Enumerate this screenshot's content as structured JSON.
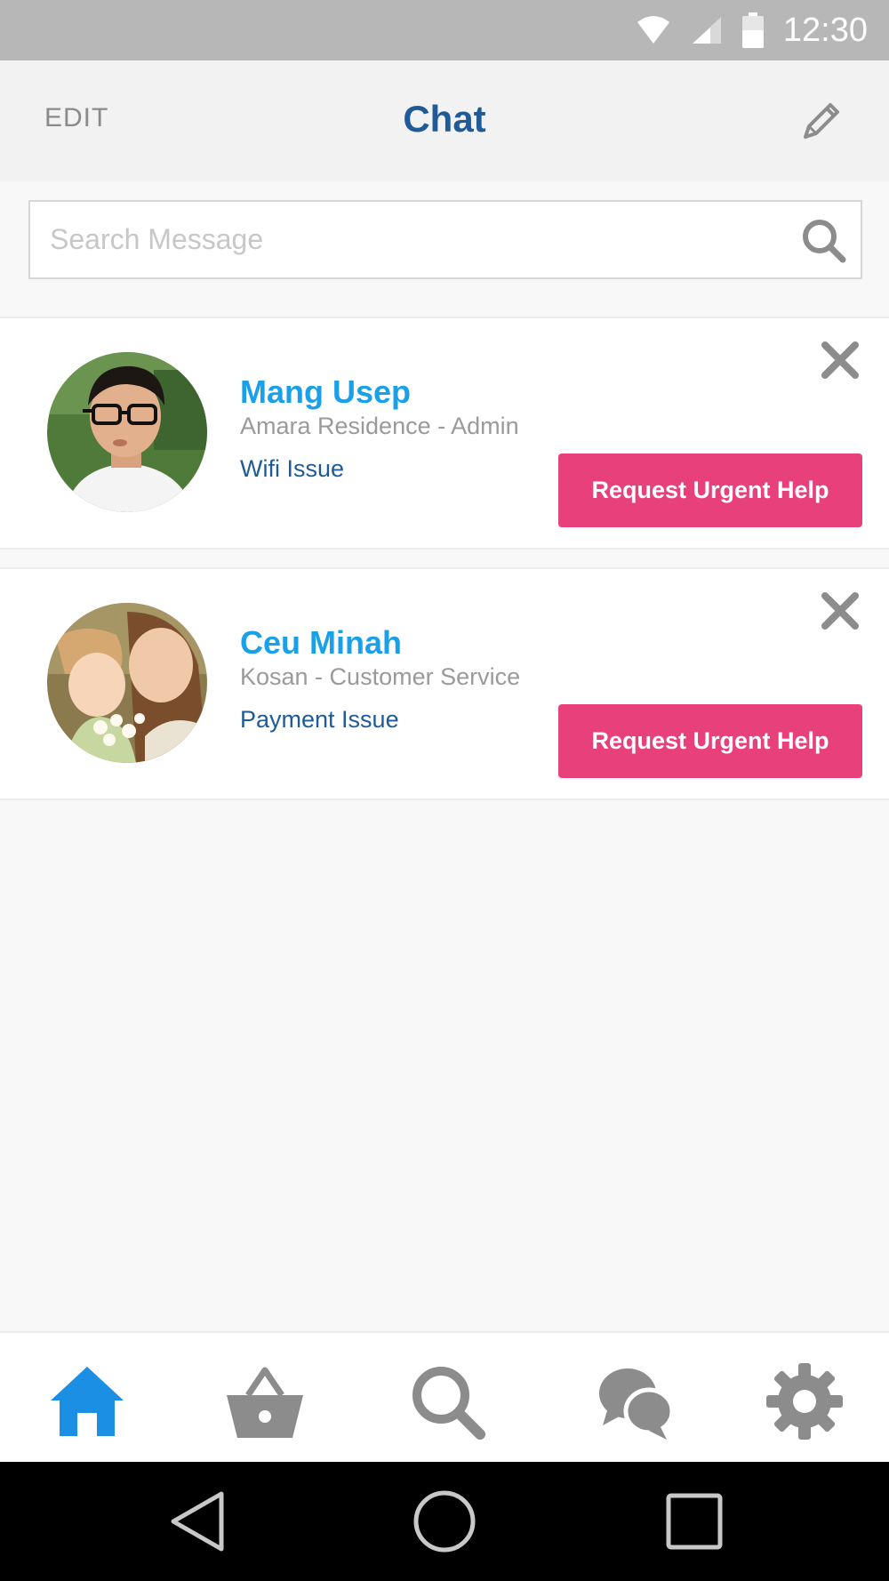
{
  "status_bar": {
    "time": "12:30",
    "icons": [
      "wifi-icon",
      "signal-icon",
      "battery-icon"
    ]
  },
  "header": {
    "edit_label": "EDIT",
    "title": "Chat",
    "compose_icon": "pencil-icon"
  },
  "search": {
    "placeholder": "Search Message",
    "value": "",
    "icon": "search-icon"
  },
  "chats": [
    {
      "name": "Mang Usep",
      "role": "Amara Residence - Admin",
      "issue": "Wifi Issue",
      "button_label": "Request Urgent Help",
      "avatar": "avatar-mang-usep"
    },
    {
      "name": "Ceu Minah",
      "role": "Kosan - Customer Service",
      "issue": "Payment Issue",
      "button_label": "Request Urgent Help",
      "avatar": "avatar-ceu-minah"
    }
  ],
  "bottom_nav": [
    {
      "icon": "home-icon",
      "active": true
    },
    {
      "icon": "basket-icon",
      "active": false
    },
    {
      "icon": "search-icon",
      "active": false
    },
    {
      "icon": "chat-bubbles-icon",
      "active": false
    },
    {
      "icon": "gear-icon",
      "active": false
    }
  ],
  "system_nav": [
    "back-icon",
    "home-circle-icon",
    "recents-icon"
  ],
  "colors": {
    "accent_blue": "#1aa0e8",
    "title_blue": "#1e5b98",
    "urgent_pink": "#e8407a",
    "inactive_gray": "#8c8c8c"
  }
}
